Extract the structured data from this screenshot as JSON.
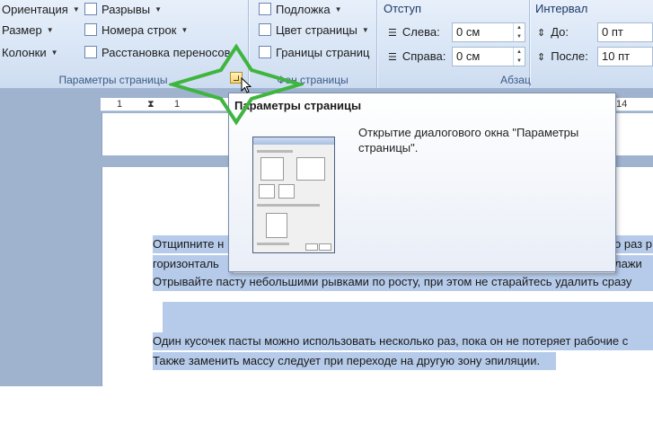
{
  "ribbon": {
    "page_setup": {
      "orientation": "Ориентация",
      "size": "Размер",
      "columns": "Колонки",
      "breaks": "Разрывы",
      "line_numbers": "Номера строк",
      "hyphenation": "Расстановка переносов",
      "group_label": "Параметры страницы"
    },
    "page_background": {
      "watermark": "Подложка",
      "page_color": "Цвет страницы",
      "page_borders": "Границы страниц",
      "group_label": "Фон страницы"
    },
    "paragraph": {
      "indent_title": "Отступ",
      "left_label": "Слева:",
      "left_value": "0 см",
      "right_label": "Справа:",
      "right_value": "0 см",
      "spacing_title": "Интервал",
      "before_label": "До:",
      "before_value": "0 пт",
      "after_label": "После:",
      "after_value": "10 пт",
      "group_label": "Абзац"
    }
  },
  "ruler": {
    "tick1": "1",
    "tick2": "1",
    "tick14": "14"
  },
  "tooltip": {
    "title": "Параметры страницы",
    "description": "Открытие диалогового окна \"Параметры страницы\"."
  },
  "document": {
    "line1_start": "Отщипните н",
    "line1_end": "о раз р",
    "line2_start": "горизонталь",
    "line2_end": "лажи",
    "line3": "Отрывайте пасту небольшими рывками по росту, при этом не старайтесь удалить сразу",
    "line4": "Один кусочек пасты можно использовать несколько раз, пока он не потеряет рабочие с",
    "line5": "Также заменить массу следует при переходе на другую зону эпиляции."
  },
  "colors": {
    "highlight": "#b6cbea",
    "annotation_star": "#3fb53f"
  }
}
